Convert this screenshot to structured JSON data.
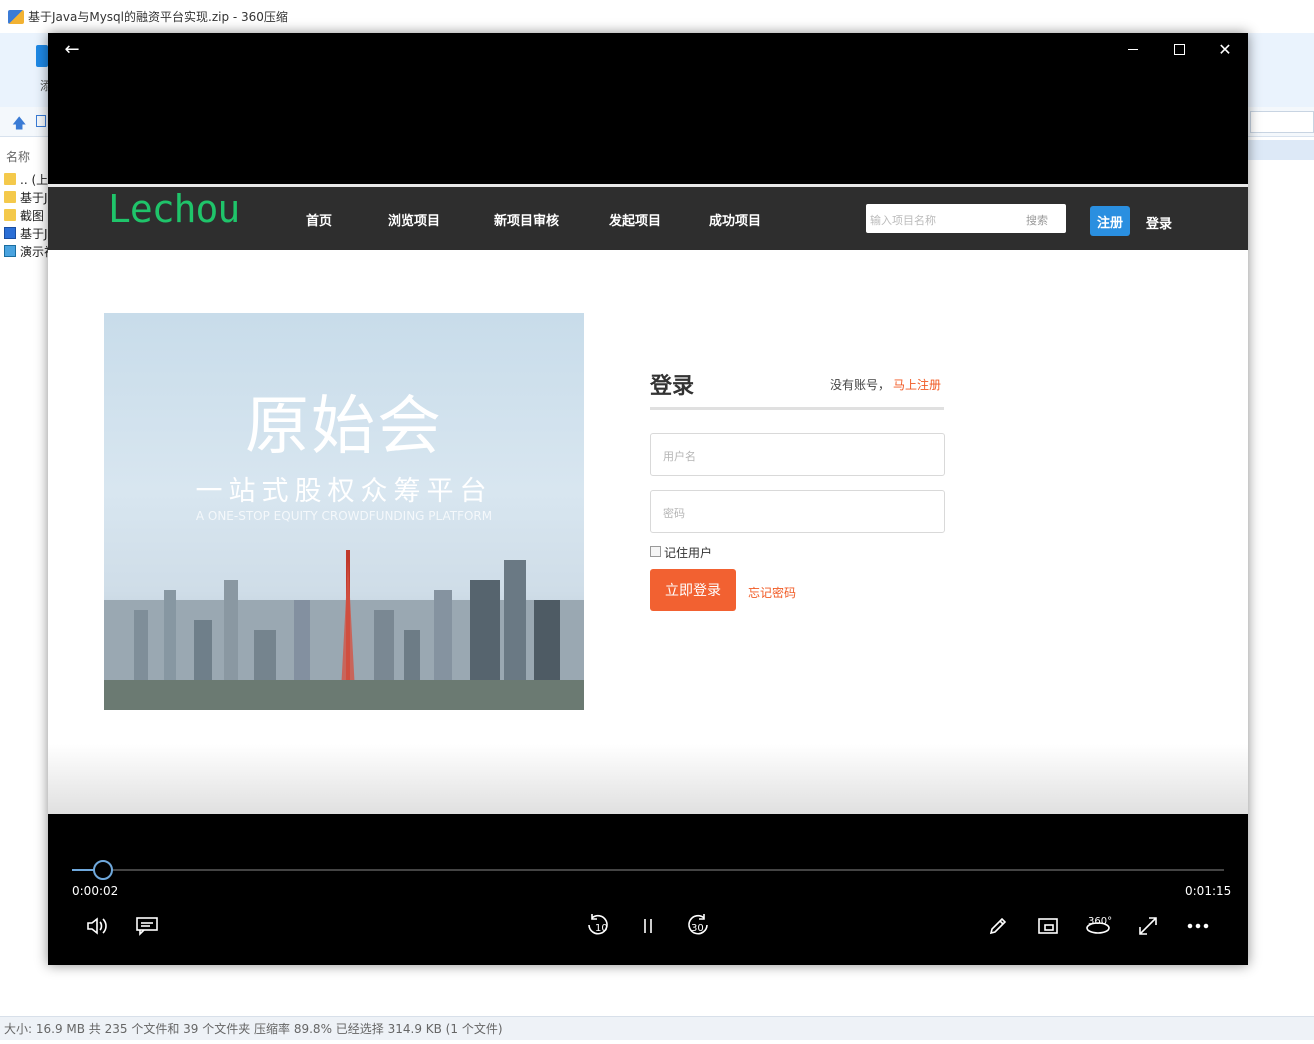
{
  "background_app": {
    "window_title": "基于Java与Mysql的融资平台实现.zip - 360压缩",
    "toolbar_label": "添",
    "column_name": "名称",
    "files": [
      {
        "name": ".. (上",
        "type": "folder"
      },
      {
        "name": "基于J",
        "type": "folder"
      },
      {
        "name": "截图",
        "type": "folder"
      },
      {
        "name": "基于J",
        "type": "doc"
      },
      {
        "name": "演示视",
        "type": "img"
      }
    ],
    "status_text": "大小: 16.9 MB 共 235 个文件和 39 个文件夹 压缩率 89.8% 已经选择 314.9 KB (1 个文件)"
  },
  "player": {
    "back_icon": "arrow-left-icon",
    "close_glyph": "✕",
    "video": {
      "site": {
        "logo": "Lechou",
        "nav": [
          "首页",
          "浏览项目",
          "新项目审核",
          "发起项目",
          "成功项目"
        ],
        "search_placeholder": "输入项目名称",
        "search_button": "搜索",
        "register_button": "注册",
        "login_link": "登录"
      },
      "banner": {
        "title": "原始会",
        "subtitle": "一站式股权众筹平台",
        "english": "A ONE-STOP EQUITY CROWDFUNDING PLATFORM"
      },
      "login_form": {
        "title": "登录",
        "no_account": "没有账号，",
        "signup_link": "马上注册",
        "username_placeholder": "用户名",
        "password_placeholder": "密码",
        "remember_label": "记住用户",
        "submit": "立即登录",
        "forgot": "忘记密码"
      }
    },
    "transport": {
      "current_time": "0:00:02",
      "total_time": "0:01:15",
      "progress_fraction": 0.027,
      "skip_back_seconds": "10",
      "skip_forward_seconds": "30",
      "view_360_label": "360°"
    },
    "accent_color": "#6fa8dc"
  }
}
